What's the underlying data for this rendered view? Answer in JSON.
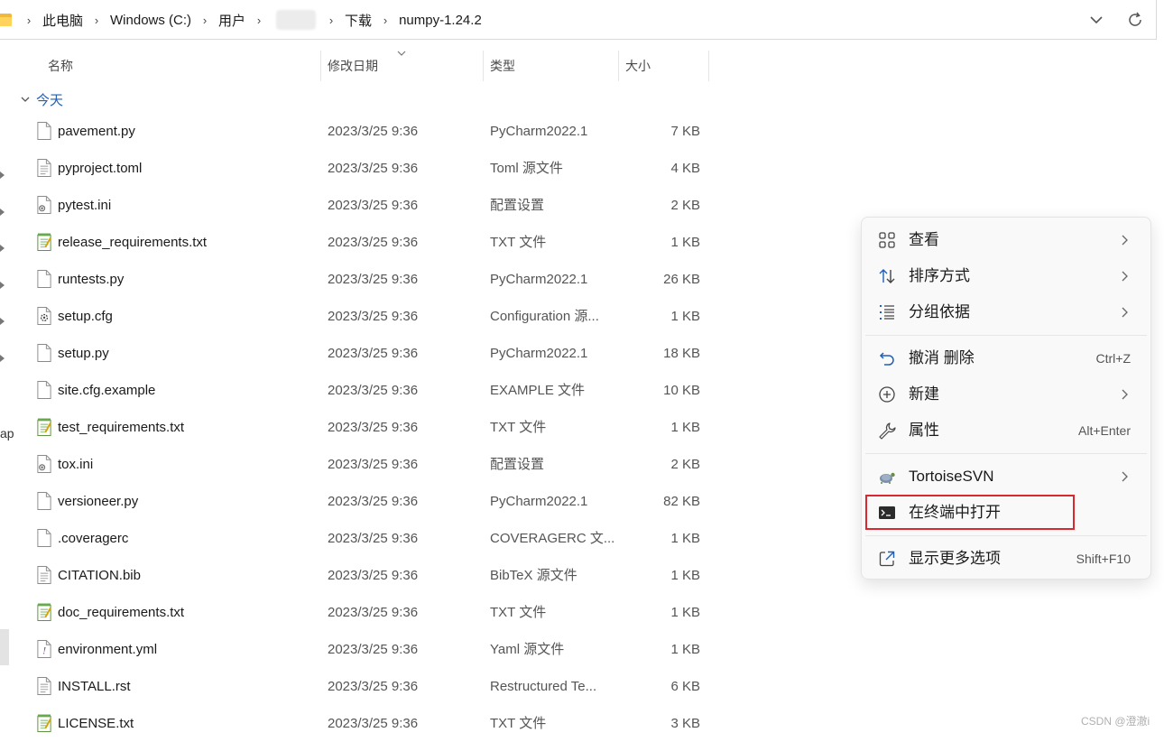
{
  "breadcrumb": {
    "items": [
      "此电脑",
      "Windows (C:)",
      "用户",
      "下载",
      "numpy-1.24.2"
    ]
  },
  "columns": {
    "name": "名称",
    "date": "修改日期",
    "type": "类型",
    "size": "大小"
  },
  "group": {
    "label": "今天"
  },
  "left_pane": {
    "partial_label": "ap"
  },
  "files": [
    {
      "name": "pavement.py",
      "date": "2023/3/25 9:36",
      "type": "PyCharm2022.1",
      "size": "7 KB",
      "icon": "python-file-icon"
    },
    {
      "name": "pyproject.toml",
      "date": "2023/3/25 9:36",
      "type": "Toml 源文件",
      "size": "4 KB",
      "icon": "text-file-icon"
    },
    {
      "name": "pytest.ini",
      "date": "2023/3/25 9:36",
      "type": "配置设置",
      "size": "2 KB",
      "icon": "config-file-icon"
    },
    {
      "name": "release_requirements.txt",
      "date": "2023/3/25 9:36",
      "type": "TXT 文件",
      "size": "1 KB",
      "icon": "notepad-file-icon"
    },
    {
      "name": "runtests.py",
      "date": "2023/3/25 9:36",
      "type": "PyCharm2022.1",
      "size": "26 KB",
      "icon": "python-file-icon"
    },
    {
      "name": "setup.cfg",
      "date": "2023/3/25 9:36",
      "type": "Configuration 源...",
      "size": "1 KB",
      "icon": "gear-file-icon"
    },
    {
      "name": "setup.py",
      "date": "2023/3/25 9:36",
      "type": "PyCharm2022.1",
      "size": "18 KB",
      "icon": "python-file-icon"
    },
    {
      "name": "site.cfg.example",
      "date": "2023/3/25 9:36",
      "type": "EXAMPLE 文件",
      "size": "10 KB",
      "icon": "blank-file-icon"
    },
    {
      "name": "test_requirements.txt",
      "date": "2023/3/25 9:36",
      "type": "TXT 文件",
      "size": "1 KB",
      "icon": "notepad-file-icon"
    },
    {
      "name": "tox.ini",
      "date": "2023/3/25 9:36",
      "type": "配置设置",
      "size": "2 KB",
      "icon": "config-file-icon"
    },
    {
      "name": "versioneer.py",
      "date": "2023/3/25 9:36",
      "type": "PyCharm2022.1",
      "size": "82 KB",
      "icon": "python-file-icon"
    },
    {
      "name": ".coveragerc",
      "date": "2023/3/25 9:36",
      "type": "COVERAGERC 文...",
      "size": "1 KB",
      "icon": "blank-file-icon"
    },
    {
      "name": "CITATION.bib",
      "date": "2023/3/25 9:36",
      "type": "BibTeX 源文件",
      "size": "1 KB",
      "icon": "text-file-icon"
    },
    {
      "name": "doc_requirements.txt",
      "date": "2023/3/25 9:36",
      "type": "TXT 文件",
      "size": "1 KB",
      "icon": "notepad-file-icon"
    },
    {
      "name": "environment.yml",
      "date": "2023/3/25 9:36",
      "type": "Yaml 源文件",
      "size": "1 KB",
      "icon": "yaml-file-icon"
    },
    {
      "name": "INSTALL.rst",
      "date": "2023/3/25 9:36",
      "type": "Restructured Te...",
      "size": "6 KB",
      "icon": "text-file-icon"
    },
    {
      "name": "LICENSE.txt",
      "date": "2023/3/25 9:36",
      "type": "TXT 文件",
      "size": "3 KB",
      "icon": "notepad-file-icon"
    }
  ],
  "context_menu": {
    "view": "查看",
    "sort": "排序方式",
    "group_by": "分组依据",
    "undo": "撤消 删除",
    "undo_shortcut": "Ctrl+Z",
    "new": "新建",
    "properties": "属性",
    "properties_shortcut": "Alt+Enter",
    "svn": "TortoiseSVN",
    "open_terminal": "在终端中打开",
    "more_options": "显示更多选项",
    "more_options_shortcut": "Shift+F10"
  },
  "colors": {
    "accent": "#1f5fb8",
    "highlight_border": "#d9282f"
  },
  "watermark": "CSDN @澄澈i"
}
